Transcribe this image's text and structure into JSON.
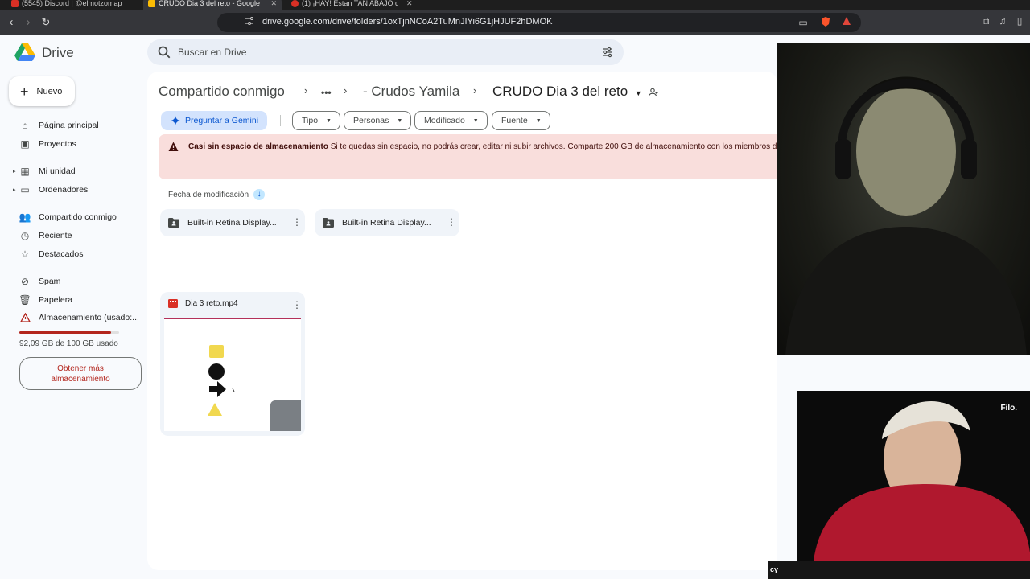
{
  "browser": {
    "tabs": [
      {
        "title": "(5545) Discord | @elmotzomap",
        "active": false
      },
      {
        "title": "CRUDO Dia 3 del reto - Google Drive",
        "active": true
      },
      {
        "title": "(1) ¡HAY! Estan TAN ABAJO que",
        "active": false
      }
    ],
    "url": "drive.google.com/drive/folders/1oxTjnNCoA2TuMnJIYi6G1jHJUF2hDMOK"
  },
  "drive": {
    "logo_text": "Drive",
    "search_placeholder": "Buscar en Drive",
    "new_button": "Nuevo",
    "nav": {
      "home": "Página principal",
      "projects": "Proyectos",
      "my_drive": "Mi unidad",
      "computers": "Ordenadores",
      "shared": "Compartido conmigo",
      "recent": "Reciente",
      "starred": "Destacados",
      "spam": "Spam",
      "trash": "Papelera",
      "storage": "Almacenamiento (usado:..."
    },
    "storage_used_fraction": 0.92,
    "storage_text": "92,09 GB de 100 GB usado",
    "get_storage": "Obtener más almacenamiento",
    "breadcrumb": {
      "root": "Compartido conmigo",
      "more": "•••",
      "parent": "- Crudos Yamila",
      "current": "CRUDO Dia 3 del reto"
    },
    "gemini_button": "Preguntar a Gemini",
    "filters": [
      "Tipo",
      "Personas",
      "Modificado",
      "Fuente"
    ],
    "alert": {
      "title": "Casi sin espacio de almacenamiento",
      "message": "Si te quedas sin espacio, no podrás crear, editar ni subir archivos. Comparte 200 GB de almacenamiento con los miembros d"
    },
    "sort_label": "Fecha de modificación",
    "folders": [
      "Built-in Retina Display...",
      "Built-in Retina Display..."
    ],
    "files": [
      {
        "name": "Dia 3 reto.mp4"
      }
    ]
  },
  "overlay": {
    "cam2_label": "Filo.",
    "bottom_text": "cy"
  }
}
